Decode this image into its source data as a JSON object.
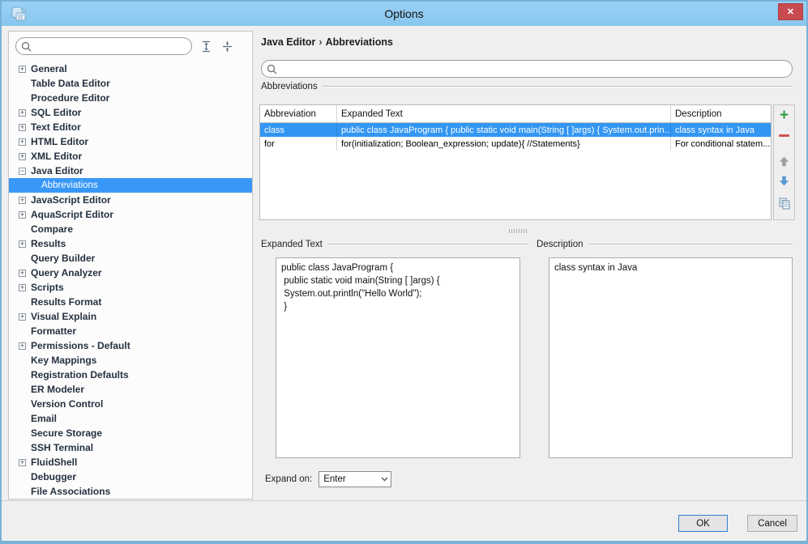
{
  "window": {
    "title": "Options",
    "close_glyph": "✕"
  },
  "colors": {
    "titlebar": "#8fccf3",
    "selection_blue": "#3296f2",
    "close_red": "#c84b50",
    "add_green": "#2c9e3f",
    "remove_red": "#cd5254"
  },
  "sidebar": {
    "search": {
      "value": "",
      "placeholder": ""
    },
    "items": [
      {
        "label": "General",
        "exp": "+",
        "child": false,
        "selected": false
      },
      {
        "label": "Table Data Editor",
        "exp": "",
        "child": false,
        "selected": false
      },
      {
        "label": "Procedure Editor",
        "exp": "",
        "child": false,
        "selected": false
      },
      {
        "label": "SQL Editor",
        "exp": "+",
        "child": false,
        "selected": false
      },
      {
        "label": "Text Editor",
        "exp": "+",
        "child": false,
        "selected": false
      },
      {
        "label": "HTML Editor",
        "exp": "+",
        "child": false,
        "selected": false
      },
      {
        "label": "XML Editor",
        "exp": "+",
        "child": false,
        "selected": false
      },
      {
        "label": "Java Editor",
        "exp": "-",
        "child": false,
        "selected": false
      },
      {
        "label": "Abbreviations",
        "exp": "",
        "child": true,
        "selected": true
      },
      {
        "label": "JavaScript Editor",
        "exp": "+",
        "child": false,
        "selected": false
      },
      {
        "label": "AquaScript Editor",
        "exp": "+",
        "child": false,
        "selected": false
      },
      {
        "label": "Compare",
        "exp": "",
        "child": false,
        "selected": false
      },
      {
        "label": "Results",
        "exp": "+",
        "child": false,
        "selected": false
      },
      {
        "label": "Query Builder",
        "exp": "",
        "child": false,
        "selected": false
      },
      {
        "label": "Query Analyzer",
        "exp": "+",
        "child": false,
        "selected": false
      },
      {
        "label": "Scripts",
        "exp": "+",
        "child": false,
        "selected": false
      },
      {
        "label": "Results Format",
        "exp": "",
        "child": false,
        "selected": false
      },
      {
        "label": "Visual Explain",
        "exp": "+",
        "child": false,
        "selected": false
      },
      {
        "label": "Formatter",
        "exp": "",
        "child": false,
        "selected": false
      },
      {
        "label": "Permissions - Default",
        "exp": "+",
        "child": false,
        "selected": false
      },
      {
        "label": "Key Mappings",
        "exp": "",
        "child": false,
        "selected": false
      },
      {
        "label": "Registration Defaults",
        "exp": "",
        "child": false,
        "selected": false
      },
      {
        "label": "ER Modeler",
        "exp": "",
        "child": false,
        "selected": false
      },
      {
        "label": "Version Control",
        "exp": "",
        "child": false,
        "selected": false
      },
      {
        "label": "Email",
        "exp": "",
        "child": false,
        "selected": false
      },
      {
        "label": "Secure Storage",
        "exp": "",
        "child": false,
        "selected": false
      },
      {
        "label": "SSH Terminal",
        "exp": "",
        "child": false,
        "selected": false
      },
      {
        "label": "FluidShell",
        "exp": "+",
        "child": false,
        "selected": false
      },
      {
        "label": "Debugger",
        "exp": "",
        "child": false,
        "selected": false
      },
      {
        "label": "File Associations",
        "exp": "",
        "child": false,
        "selected": false
      }
    ]
  },
  "main": {
    "breadcrumb": {
      "parent": "Java Editor",
      "separator": "›",
      "current": "Abbreviations"
    },
    "search": {
      "value": "",
      "placeholder": ""
    },
    "groups": {
      "abbreviations": "Abbreviations",
      "expanded_text": "Expanded Text",
      "description": "Description"
    },
    "table": {
      "columns": [
        "Abbreviation",
        "Expanded Text",
        "Description"
      ],
      "rows": [
        {
          "abbreviation": "class",
          "expanded_text": "public class JavaProgram { public static void main(String [ ]args) { System.out.prin...",
          "description": "class syntax in Java",
          "selected": true
        },
        {
          "abbreviation": "for",
          "expanded_text": "for(initialization; Boolean_expression; update){ //Statements}",
          "description": "For conditional statem...",
          "selected": false
        }
      ]
    },
    "expanded_text_value": "public class JavaProgram {\n public static void main(String [ ]args) {\n System.out.println(\"Hello World\");\n }",
    "description_value": "class syntax in Java",
    "expand_on": {
      "label": "Expand on:",
      "value": "Enter"
    }
  },
  "footer": {
    "ok_label": "OK",
    "cancel_label": "Cancel"
  }
}
